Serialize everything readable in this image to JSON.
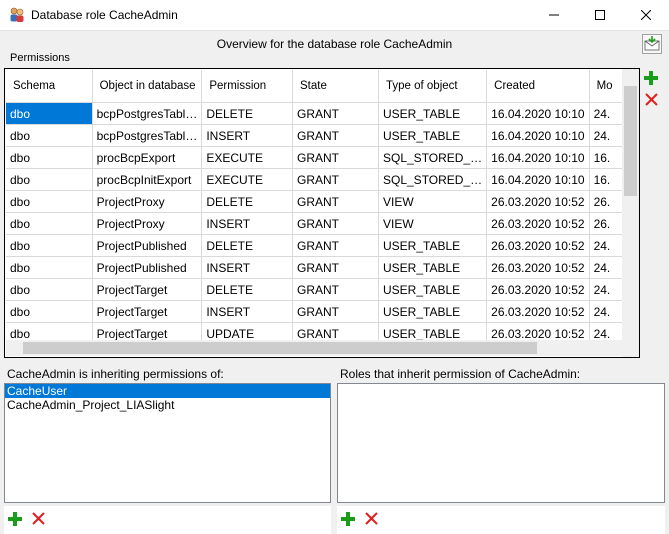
{
  "window": {
    "title": "Database role CacheAdmin",
    "controls": {
      "minimize": "minimize",
      "maximize": "maximize",
      "close": "close"
    }
  },
  "header": {
    "overview": "Overview for the database role CacheAdmin",
    "permissions_label": "Permissions"
  },
  "grid": {
    "columns": [
      "Schema",
      "Object in database",
      "Permission",
      "State",
      "Type of object",
      "Created",
      "Mo"
    ],
    "rows": [
      [
        "dbo",
        "bcpPostgresTabl…",
        "DELETE",
        "GRANT",
        "USER_TABLE",
        "16.04.2020 10:10",
        "24."
      ],
      [
        "dbo",
        "bcpPostgresTabl…",
        "INSERT",
        "GRANT",
        "USER_TABLE",
        "16.04.2020 10:10",
        "24."
      ],
      [
        "dbo",
        "procBcpExport",
        "EXECUTE",
        "GRANT",
        "SQL_STORED_…",
        "16.04.2020 10:10",
        "16."
      ],
      [
        "dbo",
        "procBcpInitExport",
        "EXECUTE",
        "GRANT",
        "SQL_STORED_…",
        "16.04.2020 10:10",
        "16."
      ],
      [
        "dbo",
        "ProjectProxy",
        "DELETE",
        "GRANT",
        "VIEW",
        "26.03.2020 10:52",
        "26."
      ],
      [
        "dbo",
        "ProjectProxy",
        "INSERT",
        "GRANT",
        "VIEW",
        "26.03.2020 10:52",
        "26."
      ],
      [
        "dbo",
        "ProjectPublished",
        "DELETE",
        "GRANT",
        "USER_TABLE",
        "26.03.2020 10:52",
        "24."
      ],
      [
        "dbo",
        "ProjectPublished",
        "INSERT",
        "GRANT",
        "USER_TABLE",
        "26.03.2020 10:52",
        "24."
      ],
      [
        "dbo",
        "ProjectTarget",
        "DELETE",
        "GRANT",
        "USER_TABLE",
        "26.03.2020 10:52",
        "24."
      ],
      [
        "dbo",
        "ProjectTarget",
        "INSERT",
        "GRANT",
        "USER_TABLE",
        "26.03.2020 10:52",
        "24."
      ],
      [
        "dbo",
        "ProjectTarget",
        "UPDATE",
        "GRANT",
        "USER_TABLE",
        "26.03.2020 10:52",
        "24."
      ]
    ]
  },
  "inheriting": {
    "label": "CacheAdmin is inheriting permissions of:",
    "items": [
      "CacheUser",
      "CacheAdmin_Project_LIASlight"
    ]
  },
  "inherited_by": {
    "label": "Roles that inherit permission of CacheAdmin:",
    "items": []
  },
  "colors": {
    "selection": "#0078d7",
    "add": "#1a9e1a",
    "remove": "#e02020"
  }
}
